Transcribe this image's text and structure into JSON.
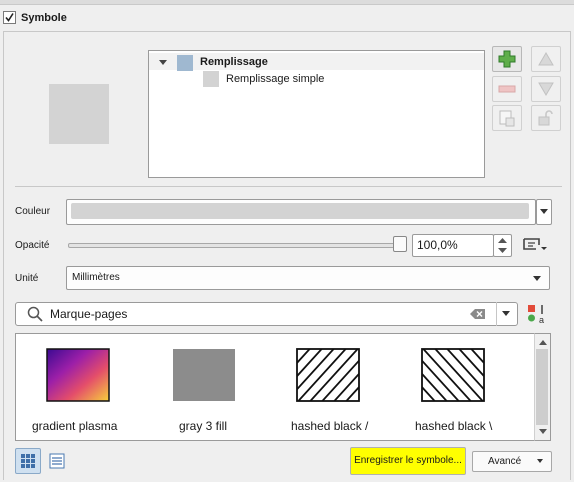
{
  "group": {
    "title": "Symbole",
    "checked": true
  },
  "layers_tree": {
    "parent": {
      "label": "Remplissage",
      "swatch_color": "#9fb8d0"
    },
    "child": {
      "label": "Remplissage simple",
      "swatch_color": "#d3d3d3"
    }
  },
  "preview_color": "#d3d3d3",
  "layer_buttons": [
    "add-layer-icon",
    "remove-layer-icon",
    "duplicate-layer-icon",
    "move-up-icon",
    "move-down-icon",
    "lock-icon"
  ],
  "color": {
    "label": "Couleur",
    "value": "#d3d3d3"
  },
  "opacity": {
    "label": "Opacité",
    "value": "100,0%",
    "fraction": 1.0
  },
  "unit": {
    "label": "Unité",
    "value": "Millimètres"
  },
  "search": {
    "value": "Marque-pages"
  },
  "gallery": [
    {
      "label": "gradient   plasma",
      "type": "gradient"
    },
    {
      "label": "gray 3 fill",
      "type": "gray"
    },
    {
      "label": "hashed black /",
      "type": "hash-forward"
    },
    {
      "label": "hashed black \\",
      "type": "hash-back"
    }
  ],
  "footer": {
    "save_label": "Enregistrer le symbole...",
    "advanced_label": "Avancé",
    "save_highlight": "#ffff00"
  }
}
